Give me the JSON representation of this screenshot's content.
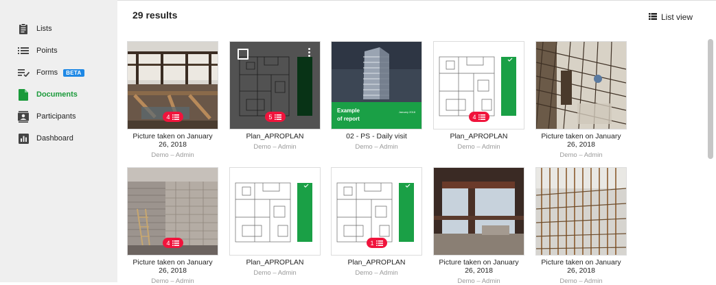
{
  "sidebar": {
    "items": [
      {
        "label": "Lists",
        "icon": "clipboard-icon",
        "active": false
      },
      {
        "label": "Points",
        "icon": "list-icon",
        "active": false
      },
      {
        "label": "Forms",
        "icon": "checklist-icon",
        "active": false,
        "badge": "BETA"
      },
      {
        "label": "Documents",
        "icon": "document-icon",
        "active": true
      },
      {
        "label": "Participants",
        "icon": "contact-icon",
        "active": false
      },
      {
        "label": "Dashboard",
        "icon": "chart-icon",
        "active": false
      }
    ]
  },
  "header": {
    "results": "29 results",
    "list_view_label": "List view"
  },
  "colors": {
    "accent_green": "#1a9a3a",
    "badge_red": "#f0143c",
    "beta_blue": "#1e88e5"
  },
  "documents": [
    {
      "title": "Picture taken on January 26, 2018",
      "subtitle": "Demo – Admin",
      "badge": "4",
      "kind": "photo-interior"
    },
    {
      "title": "Plan_APROPLAN",
      "subtitle": "Demo – Admin",
      "badge": "5",
      "kind": "plan",
      "hovered": true
    },
    {
      "title": "02 - PS - Daily visit",
      "subtitle": "Demo – Admin",
      "badge": null,
      "kind": "report",
      "cover_title": "Example of report",
      "cover_date": "January 2018"
    },
    {
      "title": "Plan_APROPLAN",
      "subtitle": "Demo – Admin",
      "badge": "4",
      "kind": "plan"
    },
    {
      "title": "Picture taken on January 26, 2018",
      "subtitle": "Demo – Admin",
      "badge": null,
      "kind": "photo-rebar"
    },
    {
      "title": "Picture taken on January 26, 2018",
      "subtitle": "Demo – Admin",
      "badge": "4",
      "kind": "photo-brick"
    },
    {
      "title": "Plan_APROPLAN",
      "subtitle": "Demo – Admin",
      "badge": null,
      "kind": "plan"
    },
    {
      "title": "Plan_APROPLAN",
      "subtitle": "Demo – Admin",
      "badge": "1",
      "kind": "plan"
    },
    {
      "title": "Picture taken on January 26, 2018",
      "subtitle": "Demo – Admin",
      "badge": null,
      "kind": "photo-beams"
    },
    {
      "title": "Picture taken on January 26, 2018",
      "subtitle": "Demo – Admin",
      "badge": null,
      "kind": "photo-rebar2"
    }
  ]
}
